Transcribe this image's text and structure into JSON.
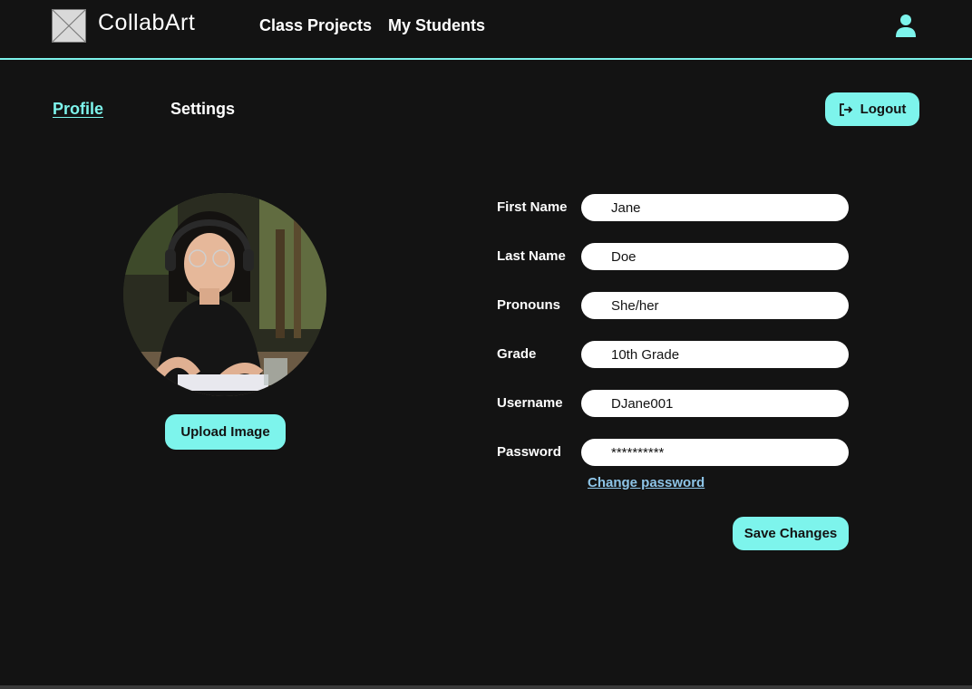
{
  "header": {
    "brand": "CollabArt",
    "nav": [
      {
        "label": "Class Projects"
      },
      {
        "label": "My Students"
      }
    ]
  },
  "tabs": {
    "profile": "Profile",
    "settings": "Settings",
    "active": "Profile"
  },
  "logout_label": "Logout",
  "avatar": {
    "upload_label": "Upload Image"
  },
  "form": {
    "fields": [
      {
        "label": "First Name",
        "value": "Jane"
      },
      {
        "label": "Last Name",
        "value": "Doe"
      },
      {
        "label": "Pronouns",
        "value": "She/her"
      },
      {
        "label": "Grade",
        "value": "10th Grade"
      },
      {
        "label": "Username",
        "value": "DJane001"
      },
      {
        "label": "Password",
        "value": "**********"
      }
    ],
    "change_password_label": "Change password",
    "save_label": "Save Changes"
  },
  "colors": {
    "accent": "#7df4ec",
    "background": "#131313",
    "link": "#8ec5e8"
  }
}
